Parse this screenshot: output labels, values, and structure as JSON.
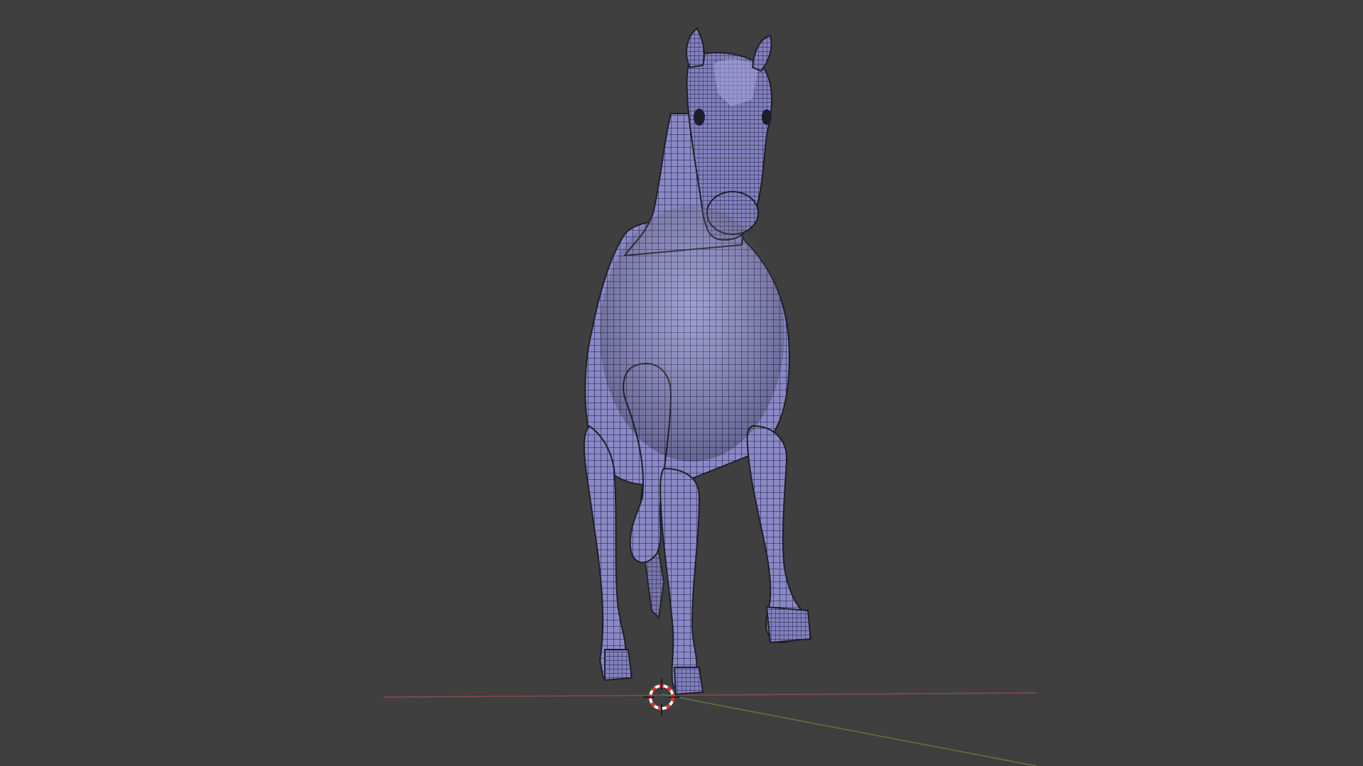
{
  "viewport": {
    "background": "#3f3f3f",
    "mode": "3d-wireframe-over-solid"
  },
  "model": {
    "subject": "horse",
    "fill_color": "#8a88c8",
    "wire_color": "#1e1e2a",
    "highlight_color": "#a8a6dc"
  },
  "scene": {
    "x_axis_color": "#8a4a4a",
    "y_axis_color": "#5d7a3a",
    "cursor_colors": [
      "#e03030",
      "#ffffff"
    ],
    "cursor_icon": "3d-cursor-icon"
  }
}
